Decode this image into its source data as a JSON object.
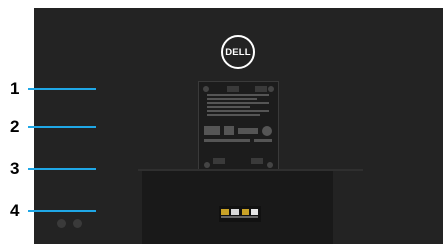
{
  "logo": {
    "text": "DELL"
  },
  "callouts": [
    {
      "number": "1"
    },
    {
      "number": "2"
    },
    {
      "number": "3"
    },
    {
      "number": "4"
    }
  ],
  "colors": {
    "callout_line": "#1fa7e6",
    "monitor_back": "#232323"
  }
}
